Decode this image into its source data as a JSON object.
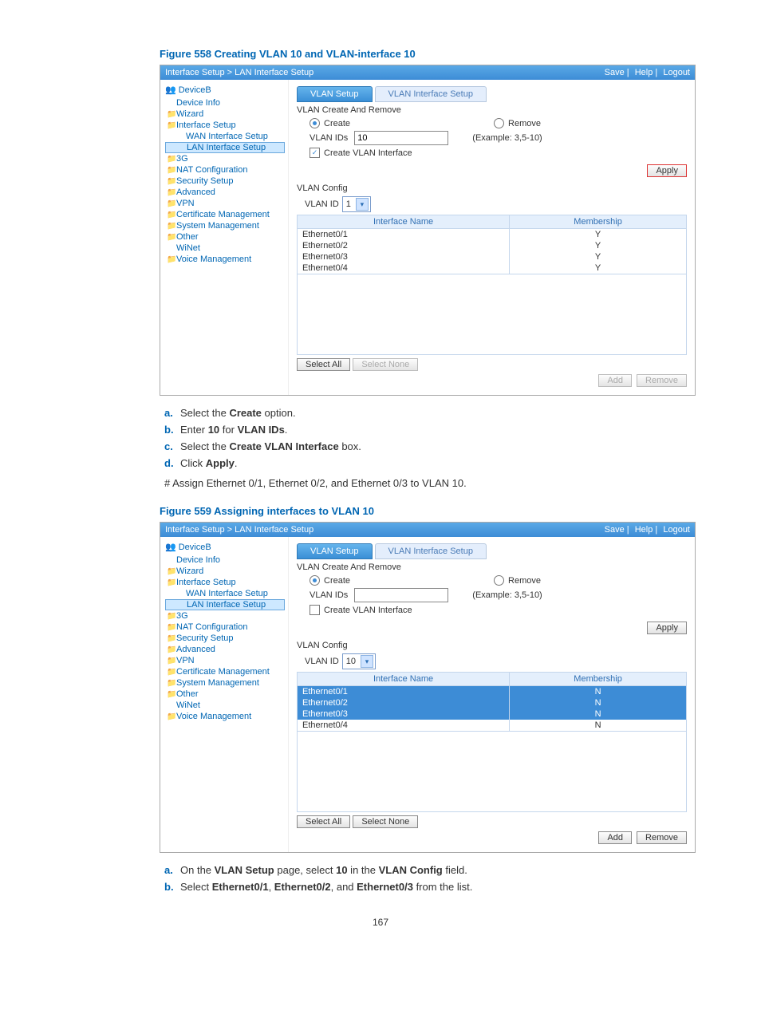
{
  "figure1": {
    "title": "Figure 558 Creating VLAN 10 and VLAN-interface 10"
  },
  "figure2": {
    "title": "Figure 559 Assigning interfaces to VLAN 10"
  },
  "breadcrumb": "Interface Setup > LAN Interface Setup",
  "topLinks": {
    "save": "Save",
    "help": "Help",
    "logout": "Logout"
  },
  "tree": {
    "root": "DeviceB",
    "items": [
      {
        "label": "Device Info",
        "icon": ""
      },
      {
        "label": "Wizard",
        "icon": "📁"
      },
      {
        "label": "Interface Setup",
        "icon": "📁"
      },
      {
        "label": "WAN Interface Setup",
        "icon": "",
        "sub": true
      },
      {
        "label": "LAN Interface Setup",
        "icon": "",
        "sub": true,
        "sel": true
      },
      {
        "label": "3G",
        "icon": "📁"
      },
      {
        "label": "NAT Configuration",
        "icon": "📁"
      },
      {
        "label": "Security Setup",
        "icon": "📁"
      },
      {
        "label": "Advanced",
        "icon": "📁"
      },
      {
        "label": "VPN",
        "icon": "📁"
      },
      {
        "label": "Certificate Management",
        "icon": "📁"
      },
      {
        "label": "System Management",
        "icon": "📁"
      },
      {
        "label": "Other",
        "icon": "📁"
      },
      {
        "label": "WiNet",
        "icon": ""
      },
      {
        "label": "Voice Management",
        "icon": "📁"
      }
    ]
  },
  "tabs": {
    "active": "VLAN Setup",
    "inactive": "VLAN Interface Setup"
  },
  "form": {
    "sectionCreate": "VLAN Create And Remove",
    "create": "Create",
    "remove": "Remove",
    "vlanIdsLabel": "VLAN IDs",
    "vlanIdsValue": "10",
    "example": "(Example: 3,5-10)",
    "createVlanIf": "Create VLAN Interface",
    "apply": "Apply",
    "vlanConfig": "VLAN Config",
    "vlanIdLabel": "VLAN ID",
    "vlanIdSel1": "1",
    "vlanIdSel2": "10",
    "colIf": "Interface Name",
    "colMem": "Membership",
    "rows1": [
      {
        "if": "Ethernet0/1",
        "m": "Y"
      },
      {
        "if": "Ethernet0/2",
        "m": "Y"
      },
      {
        "if": "Ethernet0/3",
        "m": "Y"
      },
      {
        "if": "Ethernet0/4",
        "m": "Y"
      }
    ],
    "rows2": [
      {
        "if": "Ethernet0/1",
        "m": "N",
        "sel": true
      },
      {
        "if": "Ethernet0/2",
        "m": "N",
        "sel": true
      },
      {
        "if": "Ethernet0/3",
        "m": "N",
        "sel": true
      },
      {
        "if": "Ethernet0/4",
        "m": "N"
      }
    ],
    "selectAll": "Select All",
    "selectNone": "Select None",
    "add": "Add",
    "removeBtn": "Remove"
  },
  "steps1": [
    {
      "l": "a.",
      "html": "Select the <b>Create</b> option."
    },
    {
      "l": "b.",
      "html": "Enter <b>10</b> for <b>VLAN IDs</b>."
    },
    {
      "l": "c.",
      "html": "Select the <b>Create VLAN Interface</b> box."
    },
    {
      "l": "d.",
      "html": "Click <b>Apply</b>."
    }
  ],
  "note": "# Assign Ethernet 0/1, Ethernet 0/2, and Ethernet 0/3 to VLAN 10.",
  "steps2": [
    {
      "l": "a.",
      "html": "On the <b>VLAN Setup</b> page, select <b>10</b> in the <b>VLAN Config</b> field."
    },
    {
      "l": "b.",
      "html": "Select <b>Ethernet0/1</b>, <b>Ethernet0/2</b>, and <b>Ethernet0/3</b> from the list."
    }
  ],
  "pageNum": "167"
}
